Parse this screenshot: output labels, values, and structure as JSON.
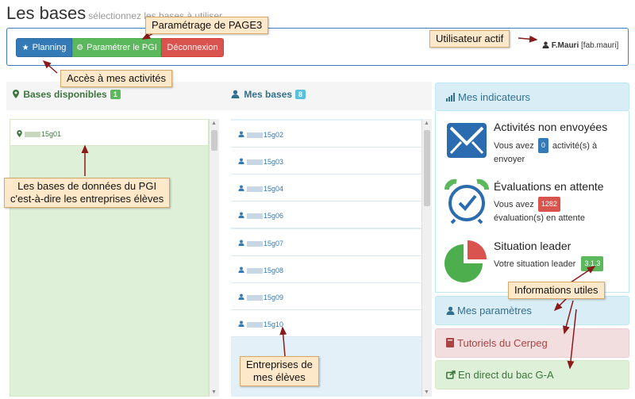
{
  "header": {
    "title": "Les bases",
    "subtitle": "sélectionnez les bases à utiliser"
  },
  "toolbar": {
    "planning_label": "Planning",
    "pgi_label": "Paramétrer le PGI",
    "logout_label": "Déconnexion"
  },
  "user": {
    "name": "F.Mauri",
    "login": "[fab.mauri]"
  },
  "available": {
    "title": "Bases disponibles",
    "count": "1",
    "items": [
      "15g01"
    ]
  },
  "mine": {
    "title": "Mes bases",
    "count": "8",
    "items": [
      "15g02",
      "15g03",
      "15g04",
      "15g06",
      "15g07",
      "15g08",
      "15g09",
      "15g10"
    ]
  },
  "indicators": {
    "title": "Mes indicateurs",
    "activities": {
      "title": "Activités non envoyées",
      "prefix": "Vous avez",
      "count": "0",
      "suffix": "activité(s) à envoyer"
    },
    "evaluations": {
      "title": "Évaluations en attente",
      "prefix": "Vous avez",
      "count": "1282",
      "suffix": "évaluation(s) en attente"
    },
    "leader": {
      "title": "Situation leader",
      "text": "Votre situation leader",
      "version": "3.1.3"
    }
  },
  "panels": {
    "params": "Mes paramètres",
    "tutorials": "Tutoriels du Cerpeg",
    "bac": "En direct du bac G-A"
  },
  "annotations": {
    "page3": "Paramétrage de PAGE3",
    "user": "Utilisateur actif",
    "activities": "Accès à mes activités",
    "databases_line1": "Les bases de données du PGI",
    "databases_line2": "c'est-à-dire les entreprises élèves",
    "companies_line1": "Entreprises de",
    "companies_line2": "mes élèves",
    "info": "Informations utiles"
  },
  "colors": {
    "primary": "#337ab7",
    "success": "#5cb85c",
    "danger": "#d9534f",
    "info": "#5bc0de",
    "callout": "#fde9c9",
    "arrow": "#8b1a1a"
  },
  "icons": {
    "planning": "star-icon",
    "pgi": "gear-icon",
    "user": "user-icon",
    "available": "map-marker-icon",
    "indicators": "bar-chart-icon",
    "activities": "envelope-icon",
    "evaluations": "alarm-clock-icon",
    "leader": "pie-chart-icon",
    "tutorials": "book-icon",
    "bac": "share-icon"
  }
}
